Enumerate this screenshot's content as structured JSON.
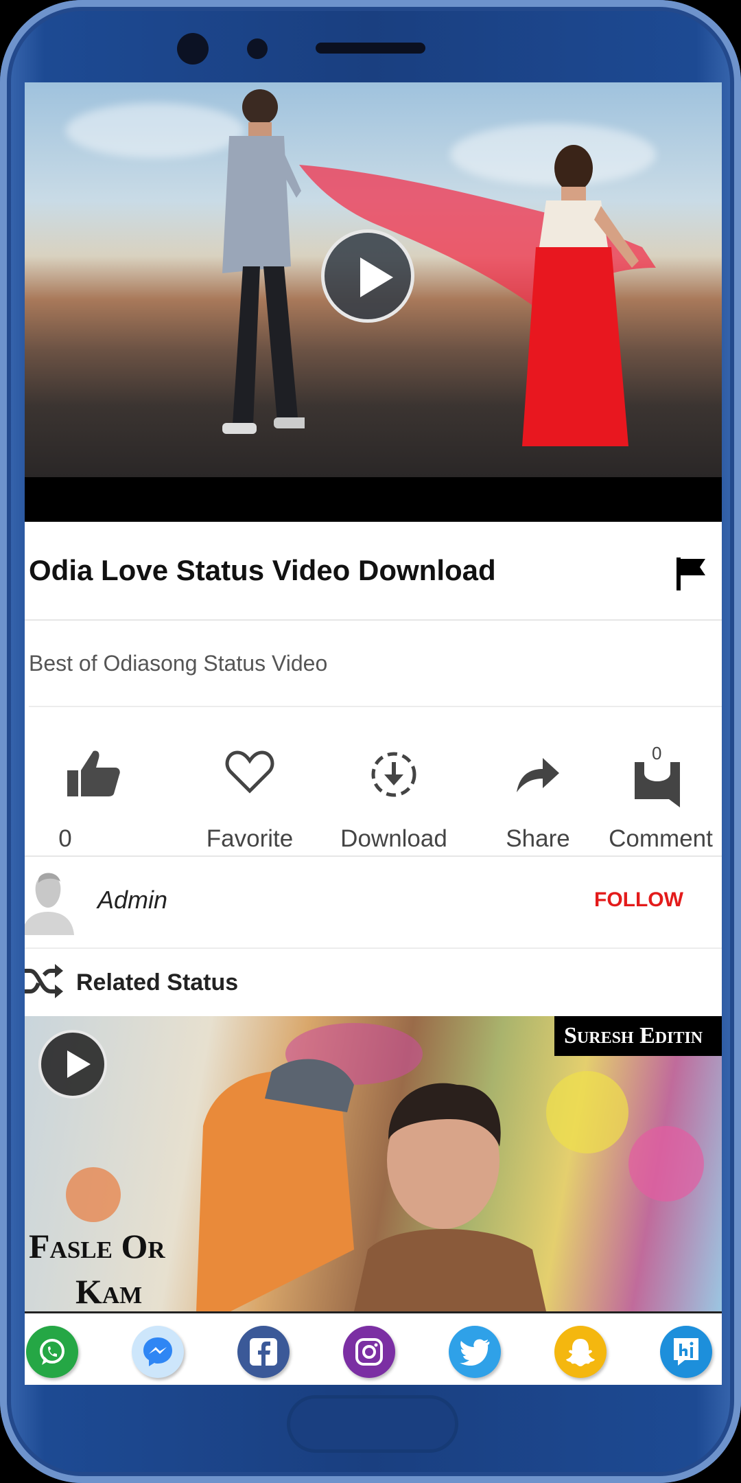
{
  "video": {
    "title": "Odia Love Status Video Download",
    "description": "Best of Odiasong Status Video"
  },
  "actions": {
    "like_count": "0",
    "favorite_label": "Favorite",
    "download_label": "Download",
    "share_label": "Share",
    "comment_label": "Comment",
    "comment_count": "0"
  },
  "author": {
    "name": "Admin",
    "follow_label": "FOLLOW"
  },
  "related": {
    "heading": "Related Status",
    "thumb_brand": "Suresh Editin",
    "thumb_caption_line1": "Fasle Or",
    "thumb_caption_line2": "Kam"
  },
  "share_apps": [
    {
      "name": "whatsapp-icon",
      "color": "#25a745"
    },
    {
      "name": "messenger-icon",
      "color": "#3a8bf5"
    },
    {
      "name": "facebook-icon",
      "color": "#3b5998"
    },
    {
      "name": "instagram-icon",
      "color": "#7b2fa3"
    },
    {
      "name": "twitter-icon",
      "color": "#2fa1e8"
    },
    {
      "name": "snapchat-icon",
      "color": "#f4b70f"
    },
    {
      "name": "hike-icon",
      "color": "#1d8fdb"
    }
  ],
  "colors": {
    "follow": "#e31b1b",
    "phone_frame": "#1a3f80"
  }
}
